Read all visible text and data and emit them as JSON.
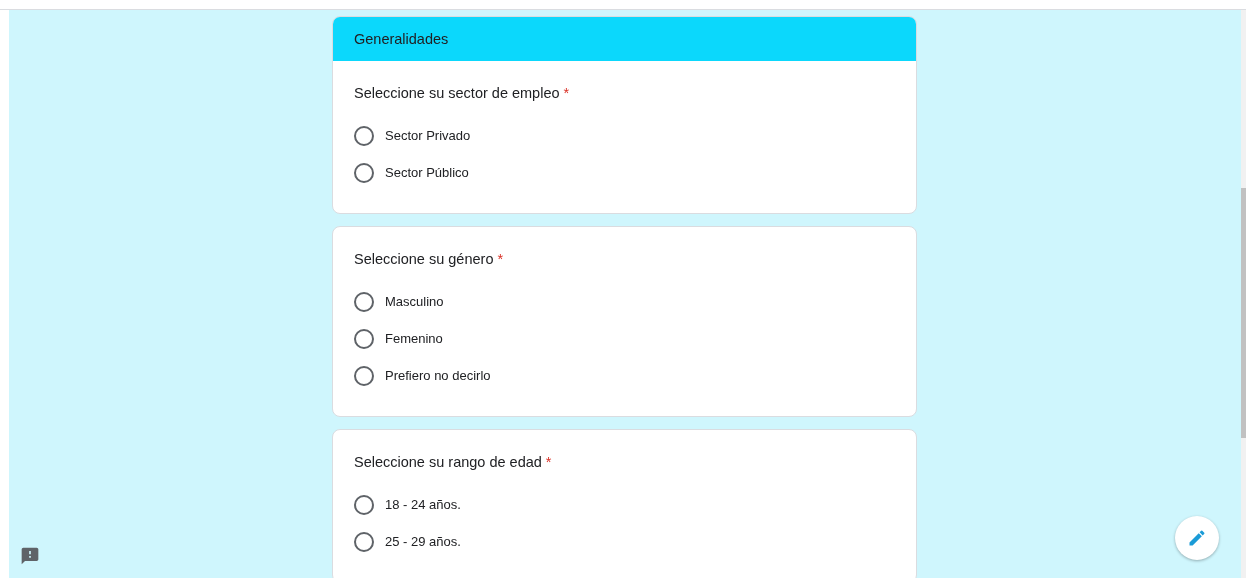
{
  "section": {
    "title": "Generalidades"
  },
  "questions": [
    {
      "text": "Seleccione su sector de empleo",
      "required_mark": "*",
      "options": [
        {
          "label": "Sector Privado",
          "selected": false
        },
        {
          "label": "Sector Público",
          "selected": false
        }
      ]
    },
    {
      "text": "Seleccione su género",
      "required_mark": "*",
      "options": [
        {
          "label": "Masculino",
          "selected": false
        },
        {
          "label": "Femenino",
          "selected": false
        },
        {
          "label": "Prefiero no decirlo",
          "selected": false
        }
      ]
    },
    {
      "text": "Seleccione su rango de edad",
      "required_mark": "*",
      "options": [
        {
          "label": "18 - 24 años.",
          "selected": false
        },
        {
          "label": "25 - 29 años.",
          "selected": false
        }
      ]
    }
  ]
}
